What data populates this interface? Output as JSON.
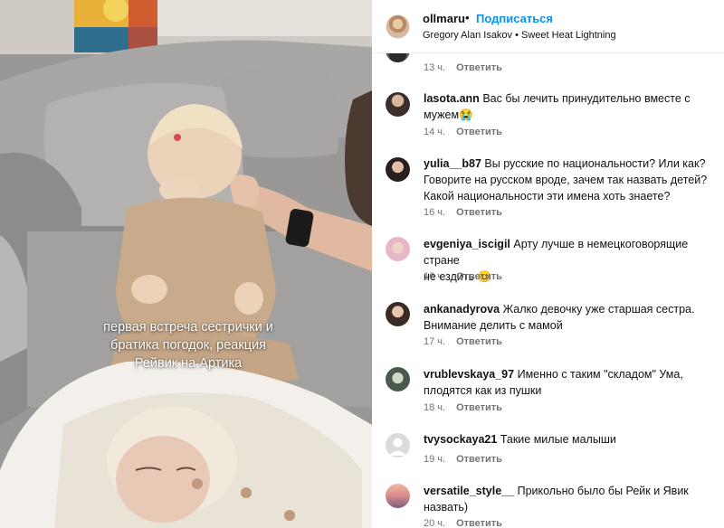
{
  "post": {
    "username": "ollmaru",
    "separator": "•",
    "follow_label": "Подписаться",
    "audio": "Gregory Alan Isakov • Sweet Heat Lightning"
  },
  "overlay_caption": "первая встреча сестрички и\nбратика погодок, реакция\nРейвик на Артика",
  "reply_label": "Ответить",
  "comments": [
    {
      "time": "13 ч."
    },
    {
      "username": "lasota.ann",
      "text": "Вас бы лечить принудительно вместе с\nмужем😭",
      "time": "14 ч."
    },
    {
      "username": "yulia__b87",
      "text": "Вы русские по национальности? Или как?\nГоворите на русском вроде, зачем так назвать детей?\nКакой национальности эти имена хоть знаете?",
      "time": "16 ч."
    },
    {
      "username": "evgeniya_iscigil",
      "text": "Арту лучше в немецкоговорящие стране\nне ездить 😊",
      "time": "16 ч."
    },
    {
      "username": "ankanadyrova",
      "text": "Жалко девочку уже старшая сестра.\nВнимание делить с мамой",
      "time": "17 ч."
    },
    {
      "username": "vrublevskaya_97",
      "text": "Именно с таким \"складом\" Ума,\nплодятся как из пушки",
      "time": "18 ч."
    },
    {
      "username": "tvysockaya21",
      "text": "Такие милые малыши",
      "time": "19 ч."
    },
    {
      "username": "versatile_style__",
      "text": "Прикольно было бы Рейк и Явик\nназвать)",
      "time": "20 ч."
    }
  ],
  "colors": {
    "link": "#0095f6",
    "meta": "#737373",
    "sofa": "#9a9896"
  }
}
